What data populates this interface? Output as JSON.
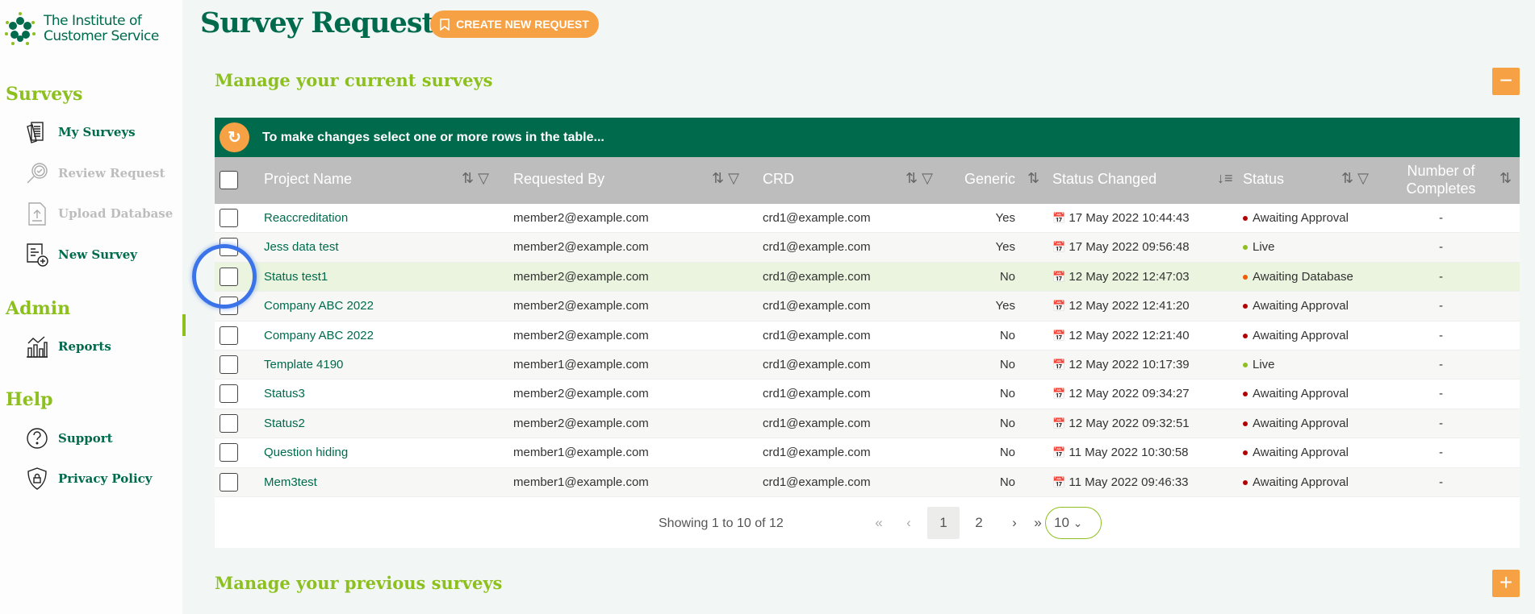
{
  "logo": {
    "line1": "The Institute of",
    "line2": "Customer Service"
  },
  "sidebar": {
    "sections": [
      {
        "title": "Surveys",
        "items": [
          {
            "label": "My Surveys",
            "icon": "documents-icon",
            "enabled": true
          },
          {
            "label": "Review Request",
            "icon": "magnifier-check-icon",
            "enabled": false
          },
          {
            "label": "Upload Database",
            "icon": "upload-file-icon",
            "enabled": false
          },
          {
            "label": "New Survey",
            "icon": "new-document-icon",
            "enabled": true
          }
        ]
      },
      {
        "title": "Admin",
        "items": [
          {
            "label": "Reports",
            "icon": "chart-icon",
            "enabled": true
          }
        ]
      },
      {
        "title": "Help",
        "items": [
          {
            "label": "Support",
            "icon": "question-icon",
            "enabled": true
          },
          {
            "label": "Privacy Policy",
            "icon": "shield-lock-icon",
            "enabled": true
          }
        ]
      }
    ]
  },
  "header": {
    "title": "Survey Requests",
    "create_label": "CREATE NEW REQUEST"
  },
  "current": {
    "title": "Manage your current surveys",
    "collapse": "−",
    "bar_text": "To make changes select one or more rows in the table...",
    "columns": [
      "Project Name",
      "Requested By",
      "CRD",
      "Generic",
      "Status Changed",
      "Status",
      "Number of Completes"
    ],
    "rows": [
      {
        "name": "Reaccreditation",
        "by": "member2@example.com",
        "crd": "crd1@example.com",
        "generic": "Yes",
        "changed": "17 May 2022 10:44:43",
        "status": "Awaiting Approval",
        "color": "#b00000",
        "completes": "-"
      },
      {
        "name": "Jess data test",
        "by": "member2@example.com",
        "crd": "crd1@example.com",
        "generic": "Yes",
        "changed": "17 May 2022 09:56:48",
        "status": "Live",
        "color": "#8dc01e",
        "completes": "-"
      },
      {
        "name": "Status test1",
        "by": "member2@example.com",
        "crd": "crd1@example.com",
        "generic": "No",
        "changed": "12 May 2022 12:47:03",
        "status": "Awaiting Database",
        "color": "#f05a00",
        "completes": "-"
      },
      {
        "name": "Company ABC 2022",
        "by": "member2@example.com",
        "crd": "crd1@example.com",
        "generic": "Yes",
        "changed": "12 May 2022 12:41:20",
        "status": "Awaiting Approval",
        "color": "#b00000",
        "completes": "-"
      },
      {
        "name": "Company ABC 2022",
        "by": "member2@example.com",
        "crd": "crd1@example.com",
        "generic": "No",
        "changed": "12 May 2022 12:21:40",
        "status": "Awaiting Approval",
        "color": "#b00000",
        "completes": "-"
      },
      {
        "name": "Template 4190",
        "by": "member1@example.com",
        "crd": "crd1@example.com",
        "generic": "No",
        "changed": "12 May 2022 10:17:39",
        "status": "Live",
        "color": "#8dc01e",
        "completes": "-"
      },
      {
        "name": "Status3",
        "by": "member2@example.com",
        "crd": "crd1@example.com",
        "generic": "No",
        "changed": "12 May 2022 09:34:27",
        "status": "Awaiting Approval",
        "color": "#b00000",
        "completes": "-"
      },
      {
        "name": "Status2",
        "by": "member2@example.com",
        "crd": "crd1@example.com",
        "generic": "No",
        "changed": "12 May 2022 09:32:51",
        "status": "Awaiting Approval",
        "color": "#b00000",
        "completes": "-"
      },
      {
        "name": "Question hiding",
        "by": "member1@example.com",
        "crd": "crd1@example.com",
        "generic": "No",
        "changed": "11 May 2022 10:30:58",
        "status": "Awaiting Approval",
        "color": "#b00000",
        "completes": "-"
      },
      {
        "name": "Mem3test",
        "by": "member1@example.com",
        "crd": "crd1@example.com",
        "generic": "No",
        "changed": "11 May 2022 09:46:33",
        "status": "Awaiting Approval",
        "color": "#b00000",
        "completes": "-"
      }
    ],
    "pager": {
      "summary": "Showing 1 to 10 of 12",
      "first": "«",
      "prev": "‹",
      "pages": [
        "1",
        "2"
      ],
      "current": "1",
      "next": "›",
      "last": "»",
      "page_size": "10"
    }
  },
  "previous": {
    "title": "Manage your previous surveys",
    "expand": "+"
  },
  "colors": {
    "brand": "#006a4d",
    "accent": "#8dc01e",
    "orange": "#f7a145"
  }
}
